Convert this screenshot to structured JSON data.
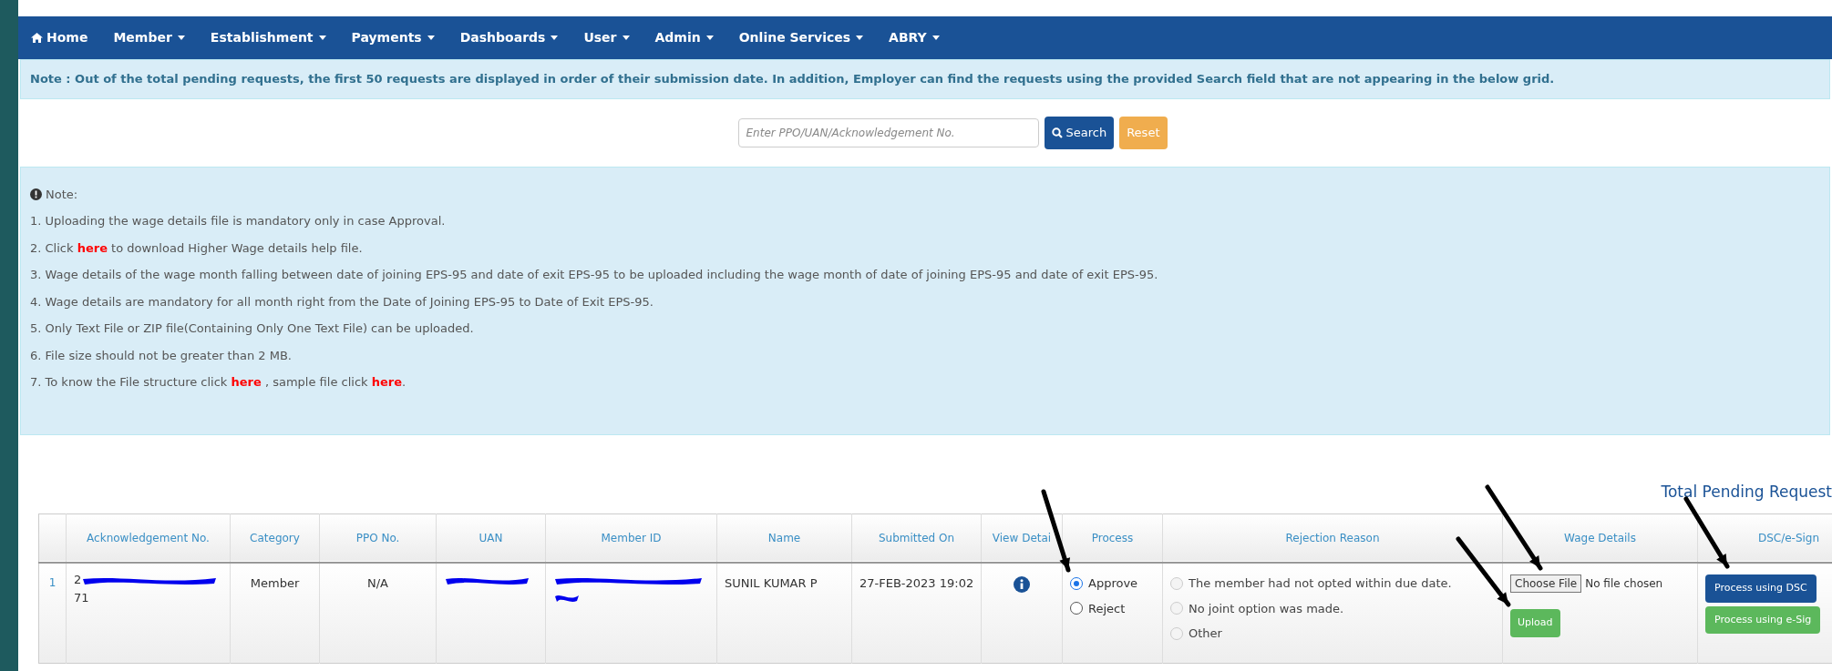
{
  "nav": [
    {
      "label": "Home",
      "kind": "home"
    },
    {
      "label": "Member",
      "kind": "menu"
    },
    {
      "label": "Establishment",
      "kind": "menu"
    },
    {
      "label": "Payments",
      "kind": "menu"
    },
    {
      "label": "Dashboards",
      "kind": "menu"
    },
    {
      "label": "User",
      "kind": "menu"
    },
    {
      "label": "Admin",
      "kind": "menu"
    },
    {
      "label": "Online Services",
      "kind": "menu"
    },
    {
      "label": "ABRY",
      "kind": "menu"
    }
  ],
  "top_note": "Note : Out of the total pending requests, the first 50 requests are displayed in order of their submission date. In addition, Employer can find the requests using the provided Search field that are not appearing in the below grid.",
  "search": {
    "placeholder": "Enter PPO/UAN/Acknowledgement No.",
    "search_button": "Search",
    "reset_button": "Reset"
  },
  "notes": {
    "title": "Note:",
    "items": [
      "1. Uploading the wage details file is mandatory only in case Approval.",
      "2. Click **here** to download Higher Wage details help file.",
      "3. Wage details of the wage month falling between date of joining EPS-95 and date of exit EPS-95 to be uploaded including the wage month of date of joining EPS-95 and date of exit EPS-95.",
      "4. Wage details are mandatory for all month right from the Date of Joining EPS-95 to Date of Exit EPS-95.",
      "5. Only Text File or ZIP file(Containing Only One Text File) can be uploaded.",
      "6. File size should not be greater than 2 MB.",
      "7. To know the File structure click **here** , sample file click **here**."
    ]
  },
  "total_label": "Total Pending Request",
  "table": {
    "columns": [
      "Acknowledgement No.",
      "Category",
      "PPO No.",
      "UAN",
      "Member ID",
      "Name",
      "Submitted On",
      "View Detai",
      "Process",
      "Rejection Reason",
      "Wage Details",
      "DSC/e-Sign"
    ],
    "rows": [
      {
        "index": "1",
        "acknowledgement_no": {
          "start": "2",
          "end": "71",
          "redacted": true
        },
        "category": "Member",
        "ppo_no": "N/A",
        "uan": {
          "redacted": true
        },
        "member_id": {
          "redacted": true
        },
        "name": "SUNIL KUMAR P",
        "submitted_on": "27-FEB-2023 19:02",
        "process": [
          {
            "label": "Approve",
            "selected": true
          },
          {
            "label": "Reject",
            "selected": false
          }
        ],
        "rejection_reasons": [
          {
            "label": "The member had not opted within due date.",
            "selected": false,
            "disabled": true
          },
          {
            "label": "No joint option was made.",
            "selected": false,
            "disabled": true
          },
          {
            "label": "Other",
            "selected": false,
            "disabled": true
          }
        ],
        "file_button": "Choose File",
        "file_status": "No file chosen",
        "upload_button": "Upload",
        "dsc_button": "Process using DSC",
        "esign_button": "Process using e-Sig"
      }
    ]
  }
}
